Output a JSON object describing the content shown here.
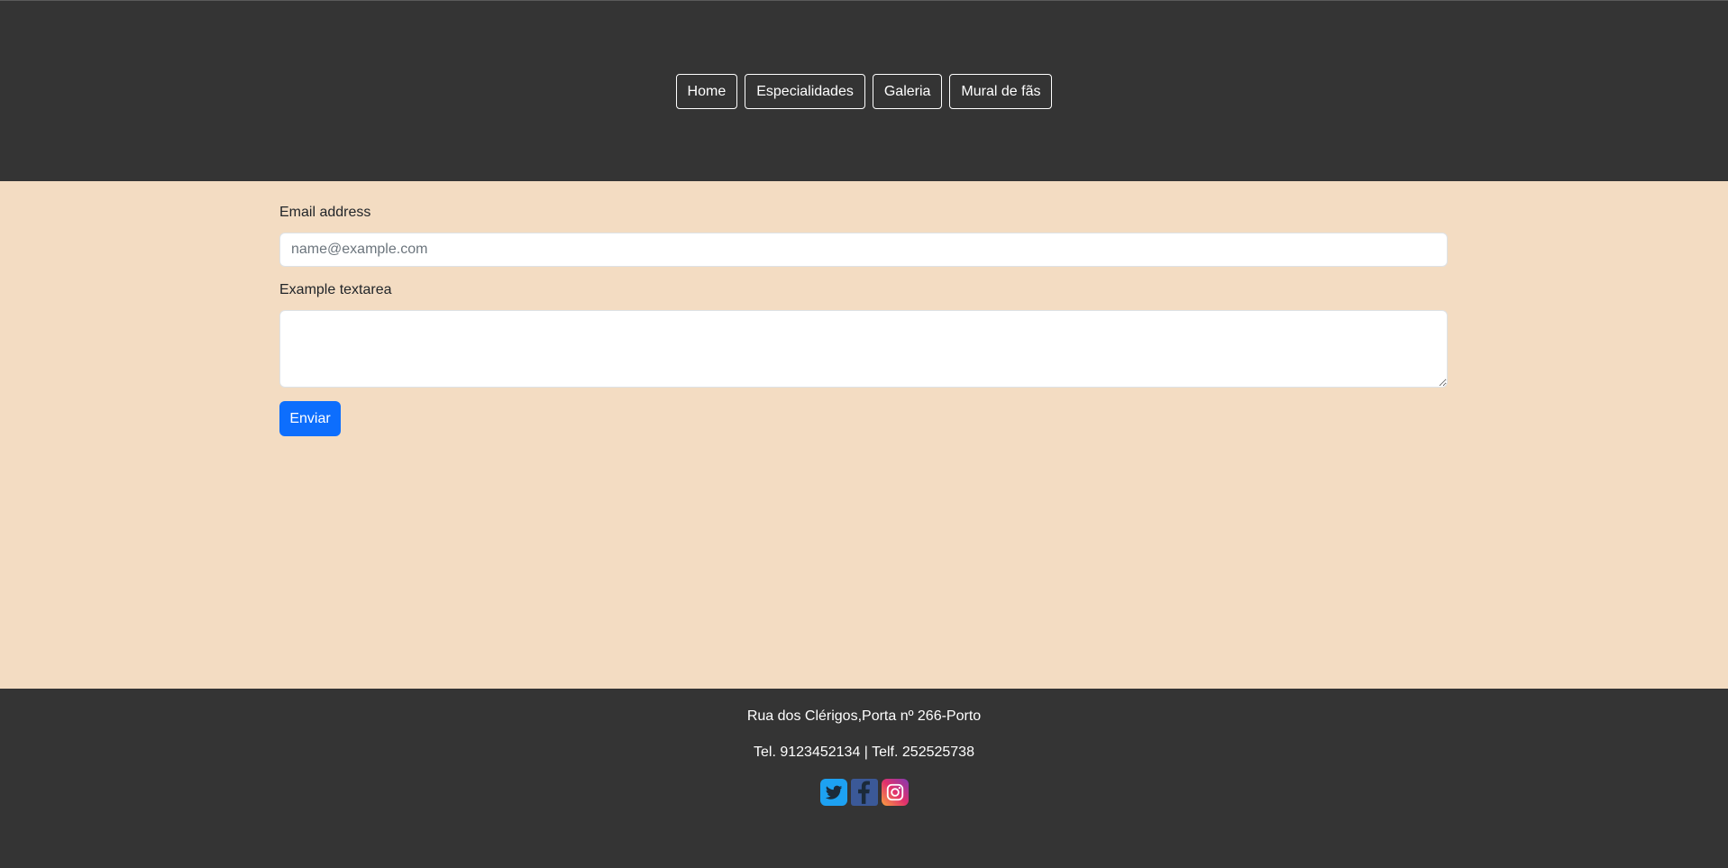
{
  "nav": {
    "items": [
      {
        "label": "Home"
      },
      {
        "label": "Especialidades"
      },
      {
        "label": "Galeria"
      },
      {
        "label": "Mural de fãs"
      }
    ]
  },
  "form": {
    "email_label": "Email address",
    "email_placeholder": "name@example.com",
    "email_value": "",
    "textarea_label": "Example textarea",
    "textarea_value": "",
    "submit_label": "Enviar"
  },
  "footer": {
    "address": "Rua dos Clérigos,Porta nº 266-Porto",
    "phones": "Tel. 9123452134 | Telf. 252525738",
    "social_icons": [
      "twitter-icon",
      "facebook-icon",
      "instagram-icon"
    ]
  },
  "colors": {
    "header_bg": "#343434",
    "main_bg": "#f3dcc2",
    "button_primary": "#0d6efd",
    "twitter": "#1da1f2",
    "facebook": "#3b5998"
  }
}
